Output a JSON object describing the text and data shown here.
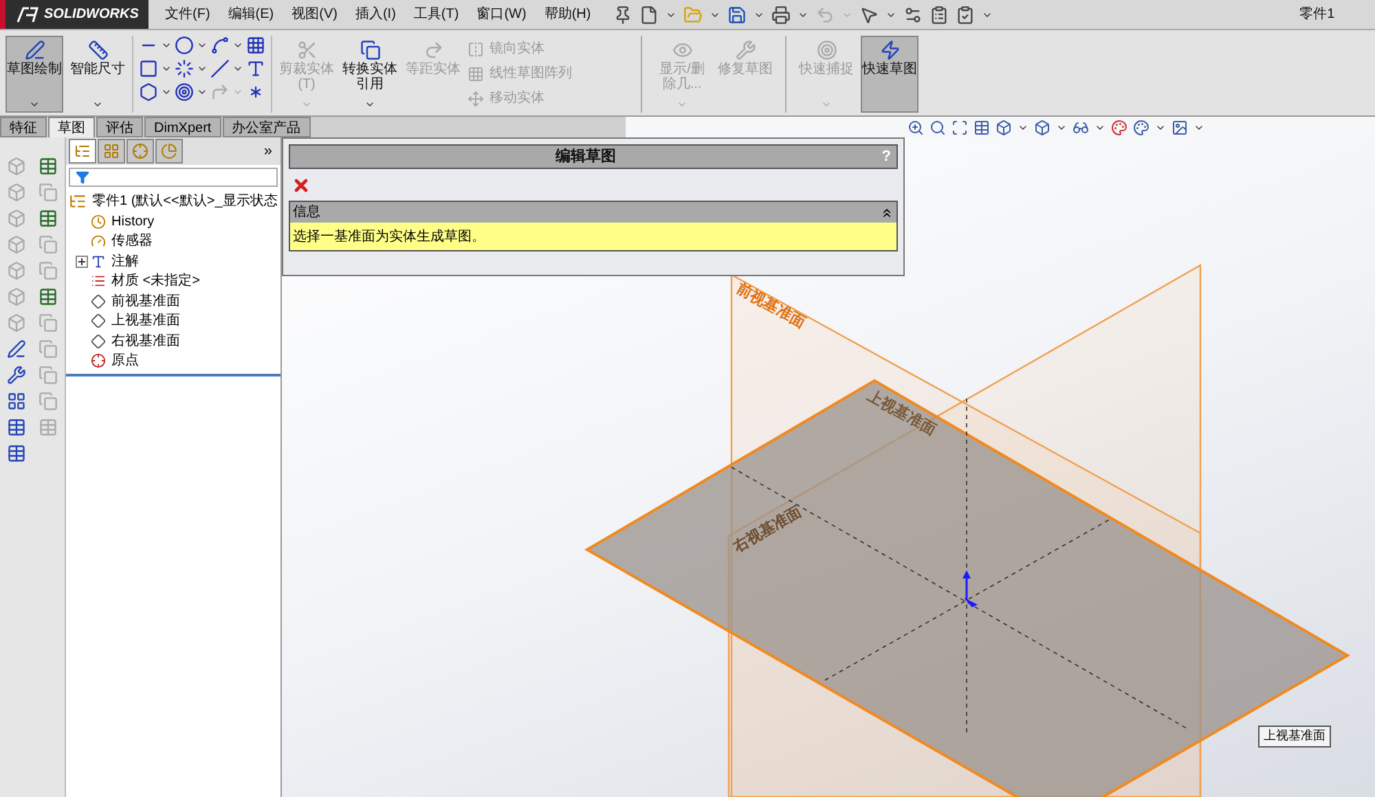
{
  "titlebar": {
    "logo": "SOLIDWORKS",
    "menu": [
      "文件(F)",
      "编辑(E)",
      "视图(V)",
      "插入(I)",
      "工具(T)",
      "窗口(W)",
      "帮助(H)"
    ],
    "document": "零件1"
  },
  "ribbon": [
    {
      "kind": "large",
      "label": "草图绘制",
      "selected": true,
      "disabled": false,
      "dropdown": true
    },
    {
      "kind": "large",
      "label": "智能尺寸",
      "selected": false,
      "disabled": false,
      "dropdown": true
    },
    {
      "kind": "tools"
    },
    {
      "kind": "large",
      "label": "剪裁实体(T)",
      "selected": false,
      "disabled": true,
      "dropdown": true
    },
    {
      "kind": "large",
      "label": "转换实体引用",
      "selected": false,
      "disabled": false,
      "dropdown": true
    },
    {
      "kind": "large",
      "label": "等距实体",
      "selected": false,
      "disabled": true,
      "dropdown": false
    },
    {
      "kind": "stack",
      "items": [
        {
          "label": "镜向实体",
          "disabled": true
        },
        {
          "label": "线性草图阵列",
          "disabled": true
        },
        {
          "label": "移动实体",
          "disabled": true
        }
      ]
    },
    {
      "kind": "separator"
    },
    {
      "kind": "large",
      "label": "显示/删除几...",
      "selected": false,
      "disabled": true,
      "dropdown": true
    },
    {
      "kind": "large",
      "label": "修复草图",
      "selected": false,
      "disabled": true,
      "dropdown": false
    },
    {
      "kind": "separator"
    },
    {
      "kind": "large",
      "label": "快速捕捉",
      "selected": false,
      "disabled": true,
      "dropdown": true
    },
    {
      "kind": "large",
      "label": "快速草图",
      "selected": true,
      "disabled": false,
      "dropdown": false
    }
  ],
  "tabs": [
    {
      "label": "特征",
      "selected": false
    },
    {
      "label": "草图",
      "selected": true
    },
    {
      "label": "评估",
      "selected": false
    },
    {
      "label": "DimXpert",
      "selected": false
    },
    {
      "label": "办公室产品",
      "selected": false
    }
  ],
  "tree_panel": {
    "tabs": [
      {
        "selected": true
      },
      {
        "selected": false
      },
      {
        "selected": false
      },
      {
        "selected": false
      }
    ],
    "more": "»",
    "root": {
      "label": "零件1  (默认<<默认>_显示状态",
      "children": [
        {
          "label": "History",
          "kind": "history"
        },
        {
          "label": "传感器",
          "kind": "sensor"
        },
        {
          "label": "注解",
          "kind": "annotation",
          "expanded": false
        },
        {
          "label": "材质 <未指定>",
          "kind": "material"
        },
        {
          "label": "前视基准面",
          "kind": "plane"
        },
        {
          "label": "上视基准面",
          "kind": "plane"
        },
        {
          "label": "右视基准面",
          "kind": "plane"
        },
        {
          "label": "原点",
          "kind": "origin"
        }
      ]
    }
  },
  "property_manager": {
    "title": "编辑草图",
    "help": "?",
    "section": {
      "title": "信息",
      "expanded": true,
      "message": "选择一基准面为实体生成草图。"
    }
  },
  "viewport": {
    "plane_labels": [
      "前视基准面",
      "上视基准面",
      "右视基准面"
    ],
    "tooltip": "上视基准面"
  }
}
